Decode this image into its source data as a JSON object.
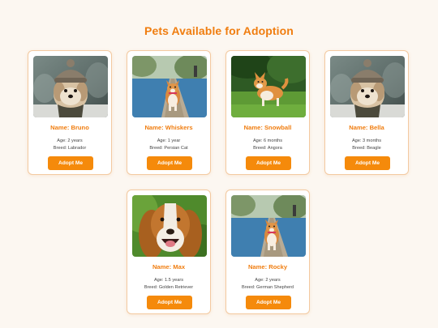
{
  "page": {
    "title": "Pets Available for Adoption"
  },
  "pets": [
    {
      "name": "Name: Bruno",
      "age": "Age: 2 years",
      "breed": "Breed: Labrador",
      "button": "Adopt Me",
      "photo": "dog-in-knit-hat-photo"
    },
    {
      "name": "Name: Whiskers",
      "age": "Age: 1 year",
      "breed": "Breed: Persian Cat",
      "button": "Adopt Me",
      "photo": "corgi-on-pier-photo"
    },
    {
      "name": "Name: Snowball",
      "age": "Age: 6 months",
      "breed": "Breed: Angora",
      "button": "Adopt Me",
      "photo": "corgi-on-grass-photo"
    },
    {
      "name": "Name: Bella",
      "age": "Age: 3 months",
      "breed": "Breed: Beagle",
      "button": "Adopt Me",
      "photo": "dog-in-knit-hat-photo"
    },
    {
      "name": "Name: Max",
      "age": "Age: 1.5 years",
      "breed": "Breed: Golden Retriever",
      "button": "Adopt Me",
      "photo": "spaniel-closeup-photo"
    },
    {
      "name": "Name: Rocky",
      "age": "Age: 2 years",
      "breed": "Breed: German Shepherd",
      "button": "Adopt Me",
      "photo": "corgi-on-pier-photo"
    }
  ],
  "colors": {
    "accent": "#f07d0f",
    "button": "#f58a0b",
    "card_border": "#f3c9a0",
    "background": "#fcf7f1"
  }
}
